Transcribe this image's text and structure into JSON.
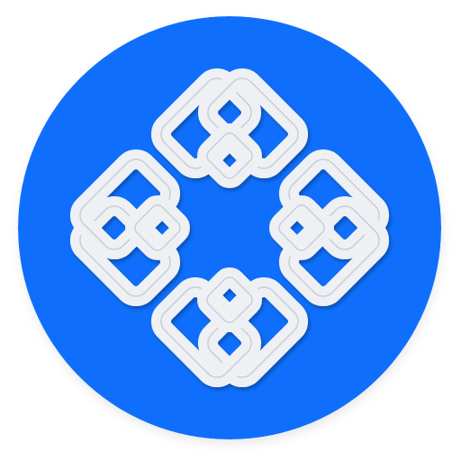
{
  "app_icon": {
    "icon_name": "celtic-knot-icon",
    "background_color": "#0f6ffc",
    "knot_color": "#eef0f4",
    "knot_shadow_color": "#b9bfc9"
  }
}
